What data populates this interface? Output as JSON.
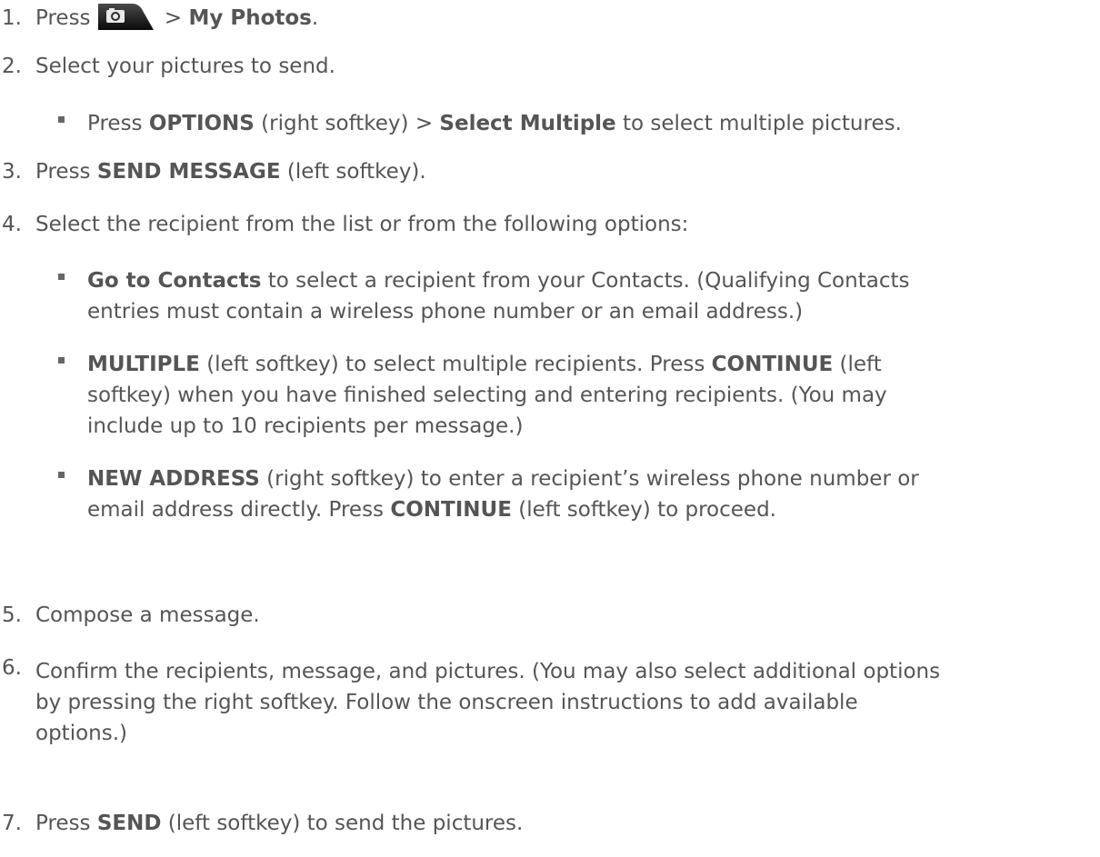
{
  "steps": [
    {
      "num": "1.",
      "t1": "Press",
      "icon": "camera-key-icon",
      "t2": " > ",
      "b1": "My Photos",
      "t3": "."
    },
    {
      "num": "2.",
      "t1": "Select your pictures to send."
    },
    {
      "num": "3.",
      "t1": "Press ",
      "b1": "SEND MESSAGE",
      "t2": " (left softkey)."
    },
    {
      "num": "4.",
      "t1": "Select the recipient from the list or from the following options:"
    },
    {
      "num": "5.",
      "t1": "Compose a message."
    },
    {
      "num": "6.",
      "line1": "Confirm the recipients, message, and pictures. (You may also select additional options",
      "line2": "by pressing the right softkey. Follow the onscreen instructions to add available",
      "line3": "options.)"
    },
    {
      "num": "7.",
      "t1": "Press ",
      "b1": "SEND",
      "t2": " (left softkey) to send the pictures."
    }
  ],
  "step2_bullet": {
    "t1": "Press ",
    "b1": "OPTIONS",
    "t2": " (right softkey) > ",
    "b2": "Select Multiple",
    "t3": " to select multiple pictures."
  },
  "step4_bullets": [
    {
      "b1": "Go to Contacts",
      "line1": " to select a recipient from your Contacts. (Qualifying Contacts",
      "line2": "entries must contain a wireless phone number or an email address.)"
    },
    {
      "b1": "MULTIPLE",
      "line1a": " (left softkey) to select multiple recipients. Press ",
      "b2": "CONTINUE",
      "line1b": " (left",
      "line2": "softkey) when you have finished selecting and entering recipients. (You may",
      "line3": "include up to 10 recipients per message.)"
    },
    {
      "b1": "NEW ADDRESS",
      "line1": " (right softkey) to enter a recipient’s wireless phone number or",
      "line2a": "email address directly. Press ",
      "b2": "CONTINUE",
      "line2b": " (left softkey) to proceed."
    }
  ]
}
